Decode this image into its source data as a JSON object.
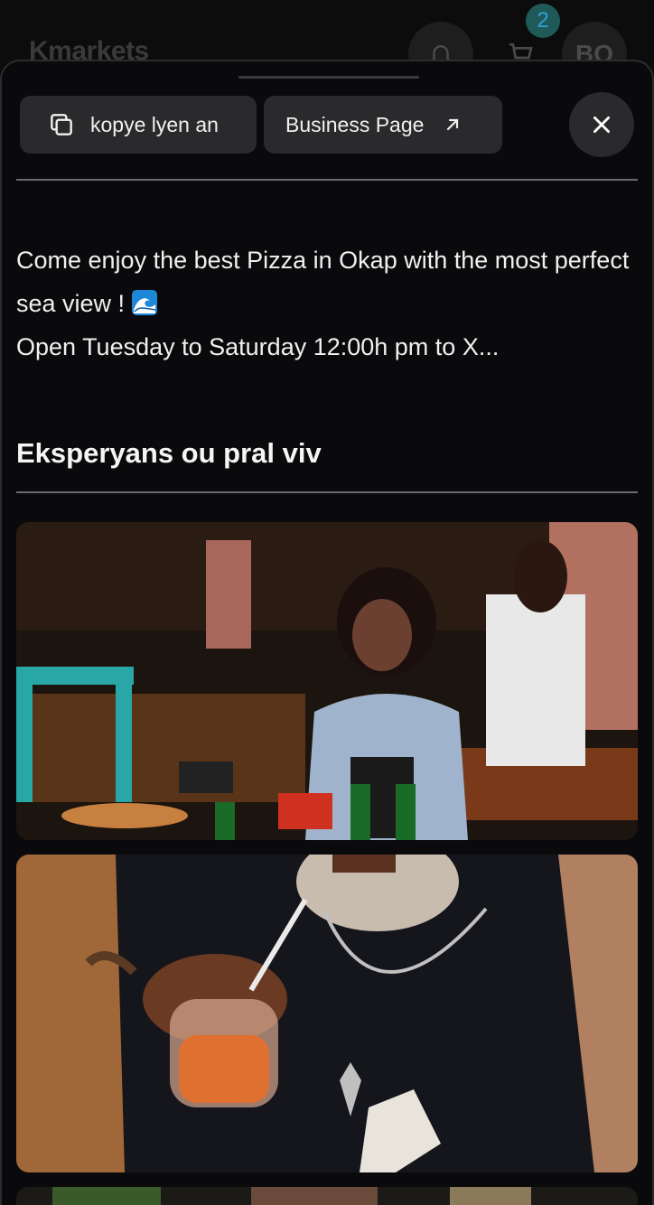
{
  "header": {
    "app_name": "Kmarkets",
    "cart_count": "2",
    "avatar_initials": "BO",
    "icons": {
      "bell": "bell-icon",
      "cart": "cart-icon"
    }
  },
  "sheet": {
    "copy_button_label": "kopye lyen an",
    "business_button_label": "Business Page",
    "icons": {
      "copy": "copy-icon",
      "external": "external-link-icon",
      "close": "close-icon"
    },
    "description": {
      "line1": "Come enjoy the best Pizza in Okap with the most perfect sea view !",
      "line2": "Open Tuesday to Saturday 12:00h pm to X..."
    },
    "section_title": "Eksperyans ou pral viv",
    "gallery": [
      {
        "alt": "Woman smiling at restaurant table with Heineken bottles and pizza"
      },
      {
        "alt": "Man holding orange drink with straw"
      },
      {
        "alt": "Third photo (partially visible)"
      }
    ]
  },
  "colors": {
    "background": "#0a0a0c",
    "button_bg": "#2a2a2c",
    "divider": "#6a6a6c",
    "badge_bg": "#1f5a58"
  }
}
